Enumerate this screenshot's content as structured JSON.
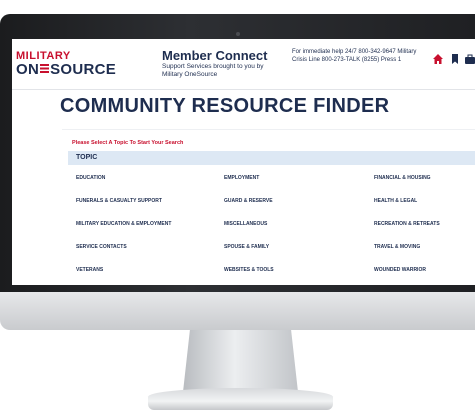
{
  "header": {
    "logo_top": "MILITARY",
    "logo_bottom_left": "ON",
    "logo_bottom_right": "SOURCE",
    "member_connect_title": "Member Connect",
    "member_connect_subtitle": "Support Services brought to you by Military OneSource",
    "help_text": "For immediate help 24/7 800-342-9647 Military Crisis Line 800-273-TALK (8255) Press 1",
    "icons": [
      "home-icon",
      "bookmark-icon",
      "briefcase-icon"
    ]
  },
  "main": {
    "title": "COMMUNITY RESOURCE FINDER",
    "prompt": "Please Select A Topic To Start Your Search",
    "topic_header": "TOPIC",
    "topics": [
      [
        "EDUCATION",
        "EMPLOYMENT",
        "FINANCIAL & HOUSING"
      ],
      [
        "FUNERALS & CASUALTY SUPPORT",
        "GUARD & RESERVE",
        "HEALTH & LEGAL"
      ],
      [
        "MILITARY EDUCATION & EMPLOYMENT",
        "MISCELLANEOUS",
        "RECREATION & RETREATS"
      ],
      [
        "SERVICE CONTACTS",
        "SPOUSE & FAMILY",
        "TRAVEL & MOVING"
      ],
      [
        "VETERANS",
        "WEBSITES & TOOLS",
        "WOUNDED WARRIOR"
      ]
    ]
  },
  "colors": {
    "navy": "#1e2d4f",
    "red": "#c8102e",
    "topic_bar": "#dde8f4"
  }
}
